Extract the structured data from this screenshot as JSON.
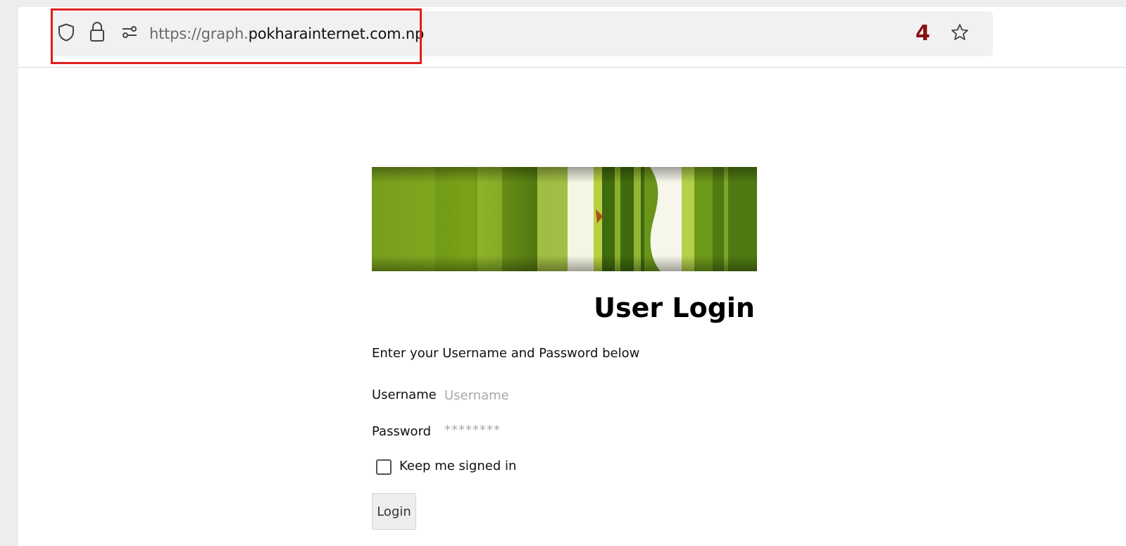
{
  "browser": {
    "url_prefix": "https://graph.",
    "url_domain": "pokharainternet.com.np",
    "annotation_number": "4",
    "annotation_color": "#e01f1f",
    "icons": [
      "shield-icon",
      "lock-icon",
      "permissions-icon",
      "star-icon"
    ]
  },
  "login": {
    "title": "User Login",
    "intro": "Enter your Username and Password below",
    "username_label": "Username",
    "username_placeholder": "Username",
    "password_label": "Password",
    "password_placeholder": "********",
    "keep_signed_in_label": "Keep me signed in",
    "button_label": "Login"
  }
}
